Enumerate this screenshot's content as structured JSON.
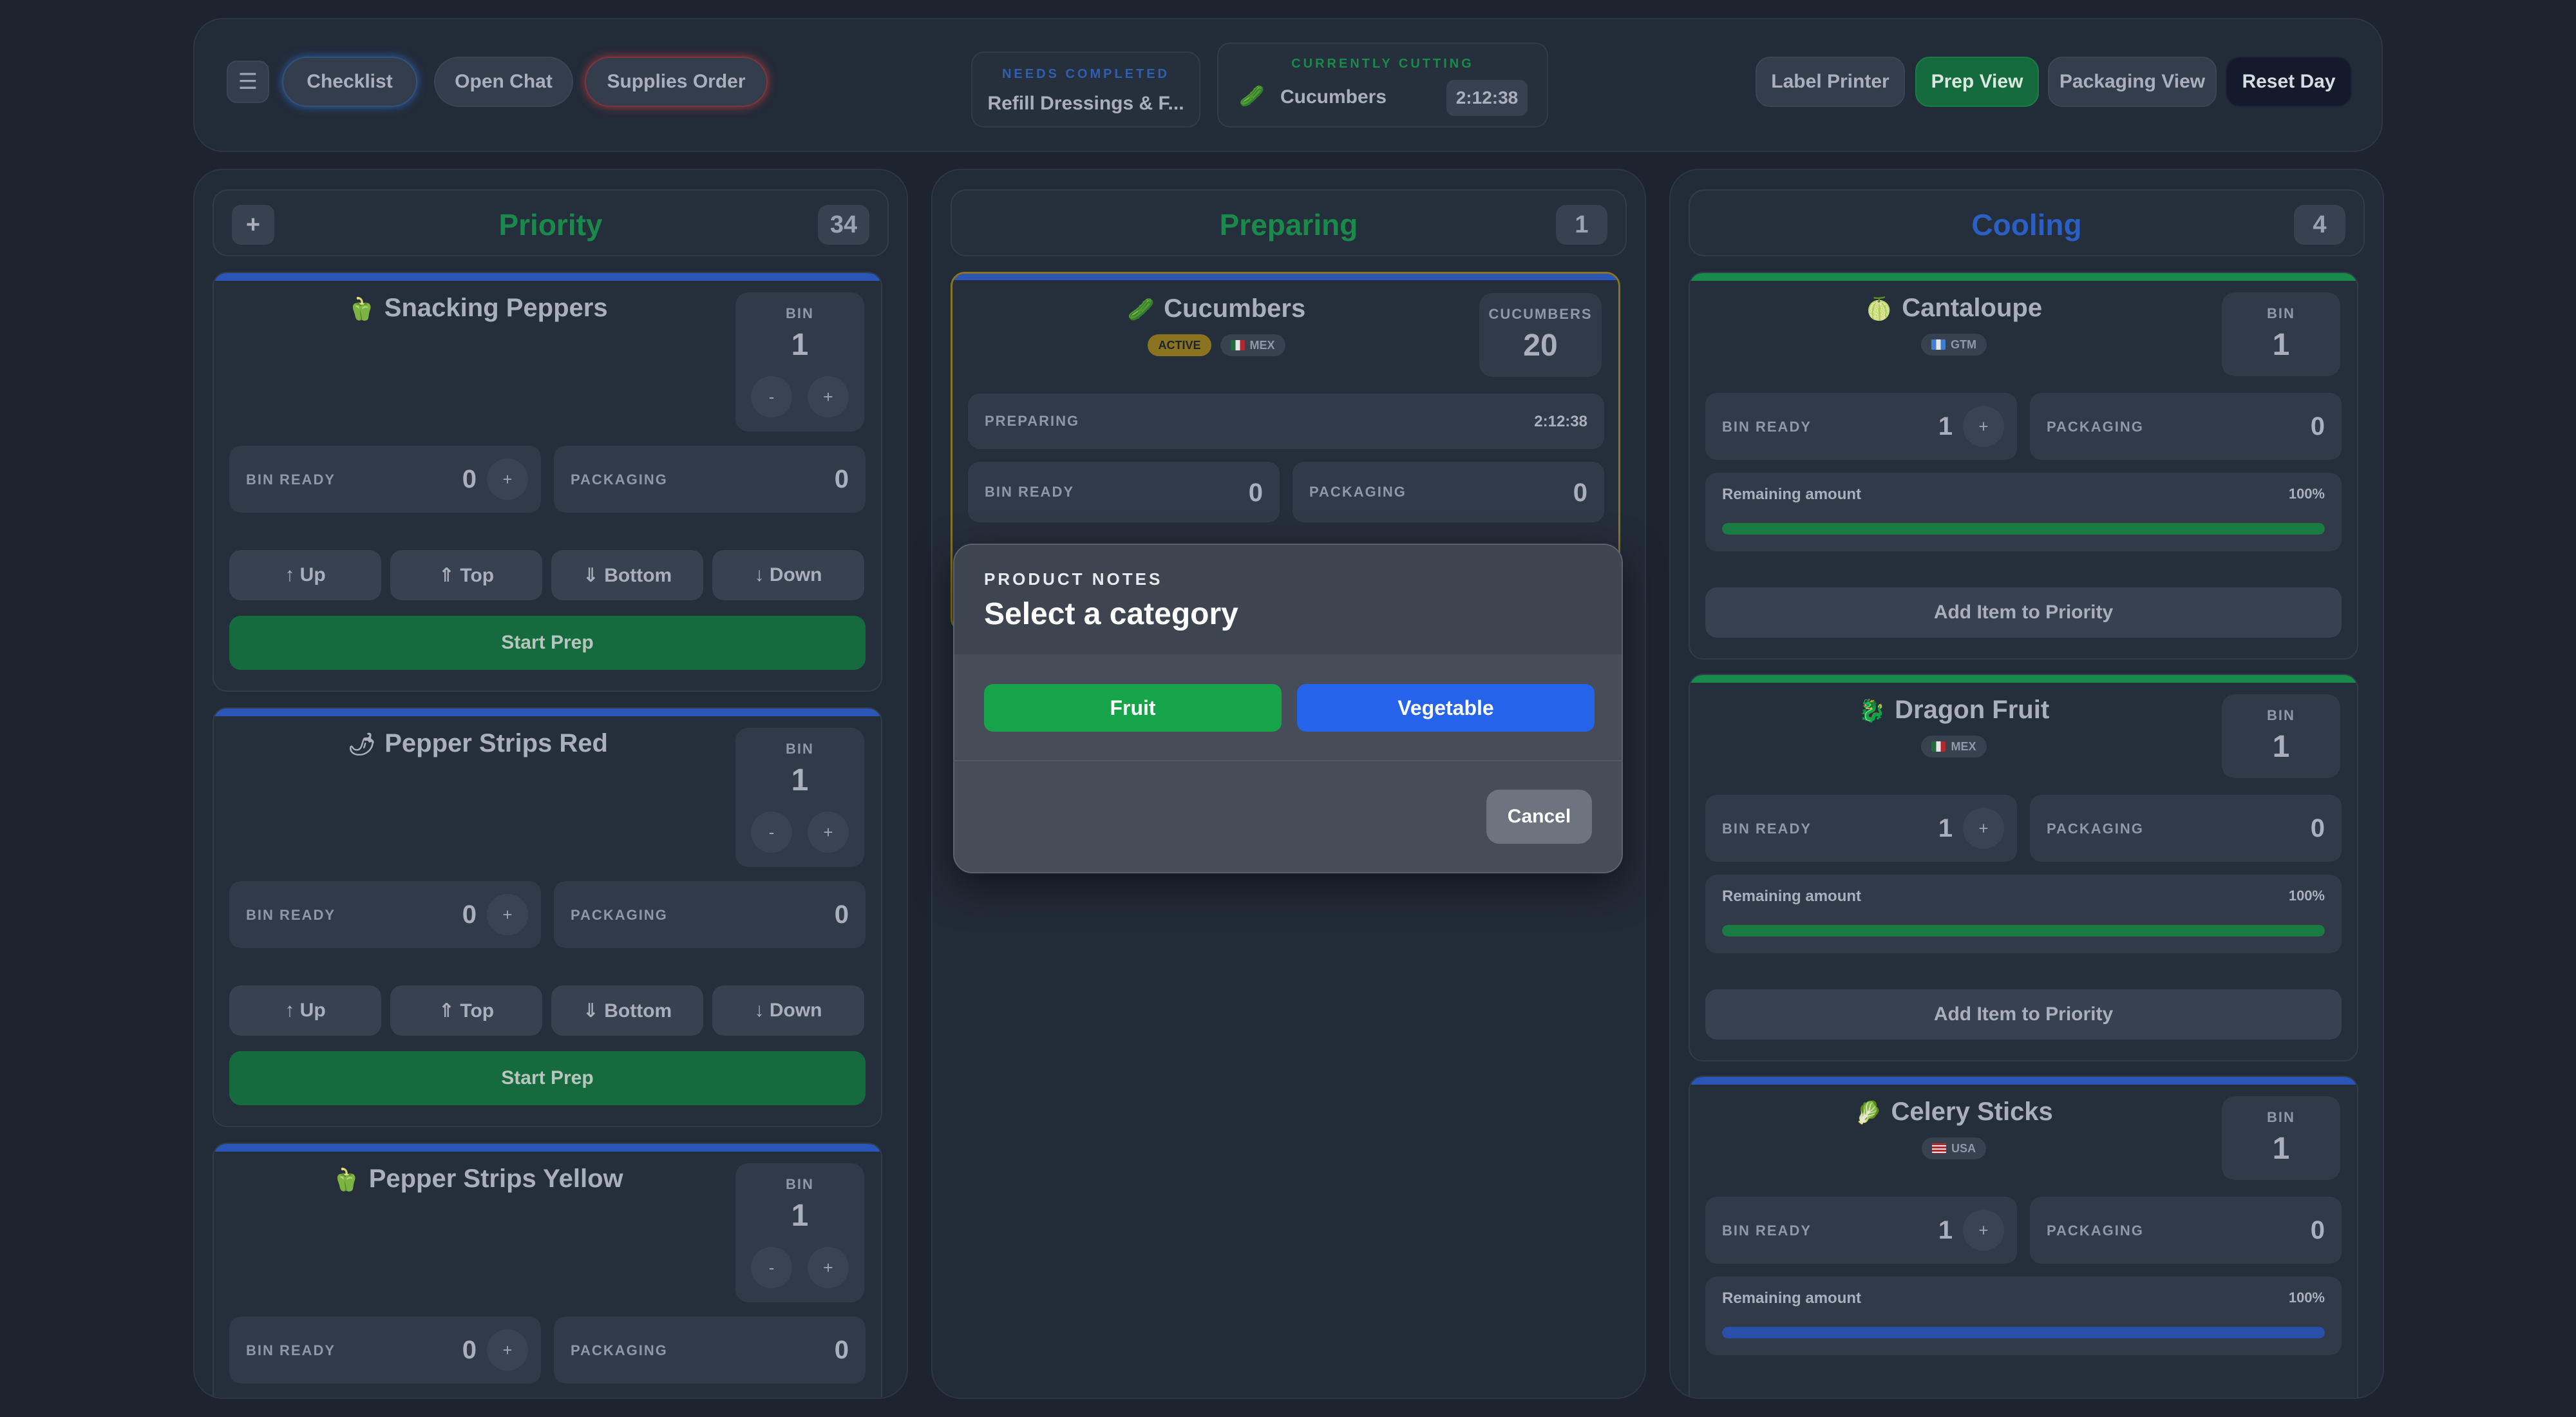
{
  "colors": {
    "background": "#1c2430",
    "priority": "#1a8a4c",
    "preparing": "#1a8a4c",
    "cooling": "#2a5fc4",
    "blue_bar": "#2a56b8",
    "green_bar": "#1a8a4c",
    "active_border": "#8a7420",
    "fruit": "#16a34a",
    "vegetable": "#2563eb"
  },
  "topbar": {
    "menu_icon": "menu-icon",
    "checklist_label": "Checklist",
    "open_chat_label": "Open Chat",
    "supplies_label": "Supplies Order",
    "needs_completed_label": "NEEDS COMPLETED",
    "needs_completed_value": "Refill Dressings & F...",
    "currently_cutting_label": "CURRENTLY CUTTING",
    "currently_cutting_item": "Cucumbers",
    "currently_cutting_timer": "2:12:38",
    "label_printer": "Label Printer",
    "prep_view": "Prep View",
    "packaging_view": "Packaging View",
    "reset_day": "Reset Day"
  },
  "priority": {
    "title": "Priority",
    "count": "34",
    "add_label": "+",
    "cards": [
      {
        "emoji": "🫑",
        "name": "Snacking Peppers",
        "bin_label": "BIN",
        "bin": "1",
        "minus": "-",
        "plus": "+",
        "bin_ready_label": "BIN READY",
        "bin_ready": "0",
        "packaging_label": "PACKAGING",
        "packaging": "0",
        "up": "↑ Up",
        "top": "⇑ Top",
        "bottom": "⇓ Bottom",
        "down": "↓ Down",
        "start": "Start Prep"
      },
      {
        "emoji": "🌶",
        "name": "Pepper Strips Red",
        "bin_label": "BIN",
        "bin": "1",
        "minus": "-",
        "plus": "+",
        "bin_ready_label": "BIN READY",
        "bin_ready": "0",
        "packaging_label": "PACKAGING",
        "packaging": "0",
        "up": "↑ Up",
        "top": "⇑ Top",
        "bottom": "⇓ Bottom",
        "down": "↓ Down",
        "start": "Start Prep"
      },
      {
        "emoji": "🫑",
        "name": "Pepper Strips Yellow",
        "bin_label": "BIN",
        "bin": "1",
        "minus": "-",
        "plus": "+",
        "bin_ready_label": "BIN READY",
        "bin_ready": "0",
        "packaging_label": "PACKAGING",
        "packaging": "0"
      }
    ]
  },
  "preparing": {
    "title": "Preparing",
    "count": "1",
    "card": {
      "emoji": "🥒",
      "name": "Cucumbers",
      "active_tag": "ACTIVE",
      "origin": "MEX",
      "count_label": "CUCUMBERS",
      "count": "20",
      "status_label": "PREPARING",
      "status_timer": "2:12:38",
      "bin_ready_label": "BIN READY",
      "bin_ready": "0",
      "packaging_label": "PACKAGING",
      "packaging": "0"
    }
  },
  "cooling": {
    "title": "Cooling",
    "count": "4",
    "cards": [
      {
        "emoji": "🍈",
        "name": "Cantaloupe",
        "origin": "GTM",
        "bin_label": "BIN",
        "bin": "1",
        "bin_ready_label": "BIN READY",
        "bin_ready": "1",
        "plus": "+",
        "packaging_label": "PACKAGING",
        "packaging": "0",
        "remaining_label": "Remaining amount",
        "remaining_pct": "100%",
        "remaining_fraction": 1.0,
        "add_label": "Add Item to Priority"
      },
      {
        "emoji": "🐉",
        "name": "Dragon Fruit",
        "origin": "MEX",
        "bin_label": "BIN",
        "bin": "1",
        "bin_ready_label": "BIN READY",
        "bin_ready": "1",
        "plus": "+",
        "packaging_label": "PACKAGING",
        "packaging": "0",
        "remaining_label": "Remaining amount",
        "remaining_pct": "100%",
        "remaining_fraction": 1.0,
        "add_label": "Add Item to Priority"
      },
      {
        "emoji": "🥬",
        "name": "Celery Sticks",
        "origin": "USA",
        "bin_label": "BIN",
        "bin": "1",
        "bin_ready_label": "BIN READY",
        "bin_ready": "1",
        "plus": "+",
        "packaging_label": "PACKAGING",
        "packaging": "0",
        "remaining_label": "Remaining amount",
        "remaining_pct": "100%",
        "remaining_fraction": 1.0
      }
    ]
  },
  "modal": {
    "kicker": "PRODUCT NOTES",
    "title": "Select a category",
    "fruit": "Fruit",
    "vegetable": "Vegetable",
    "cancel": "Cancel"
  }
}
